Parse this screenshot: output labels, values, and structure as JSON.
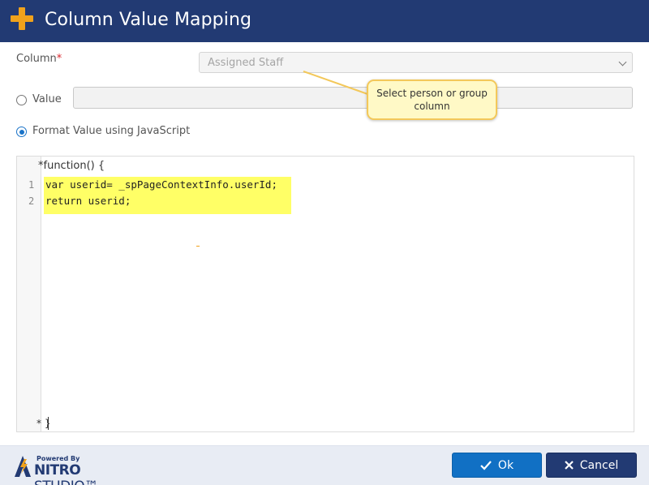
{
  "header": {
    "title": "Column Value Mapping",
    "icon": "plus-icon",
    "accent_color": "#f0a21c",
    "bg_color": "#223a73"
  },
  "form": {
    "column_label": "Column",
    "required_mark": "*",
    "column_selected": "Assigned Staff",
    "value_option_label": "Value",
    "js_option_label": "Format Value using JavaScript",
    "selected_option": "js"
  },
  "tooltip": {
    "text": "Select person or group column"
  },
  "editor": {
    "header": "*function() {",
    "footer": "* }",
    "lines": [
      {
        "number": "1",
        "text": "var userid= _spPageContextInfo.userId;"
      },
      {
        "number": "2",
        "text": "return userid;"
      }
    ]
  },
  "footer": {
    "logo_powered": "Powered By",
    "logo_nitro": "NITRO",
    "logo_studio": " STUDIO™",
    "ok_label": "Ok",
    "cancel_label": "Cancel"
  }
}
